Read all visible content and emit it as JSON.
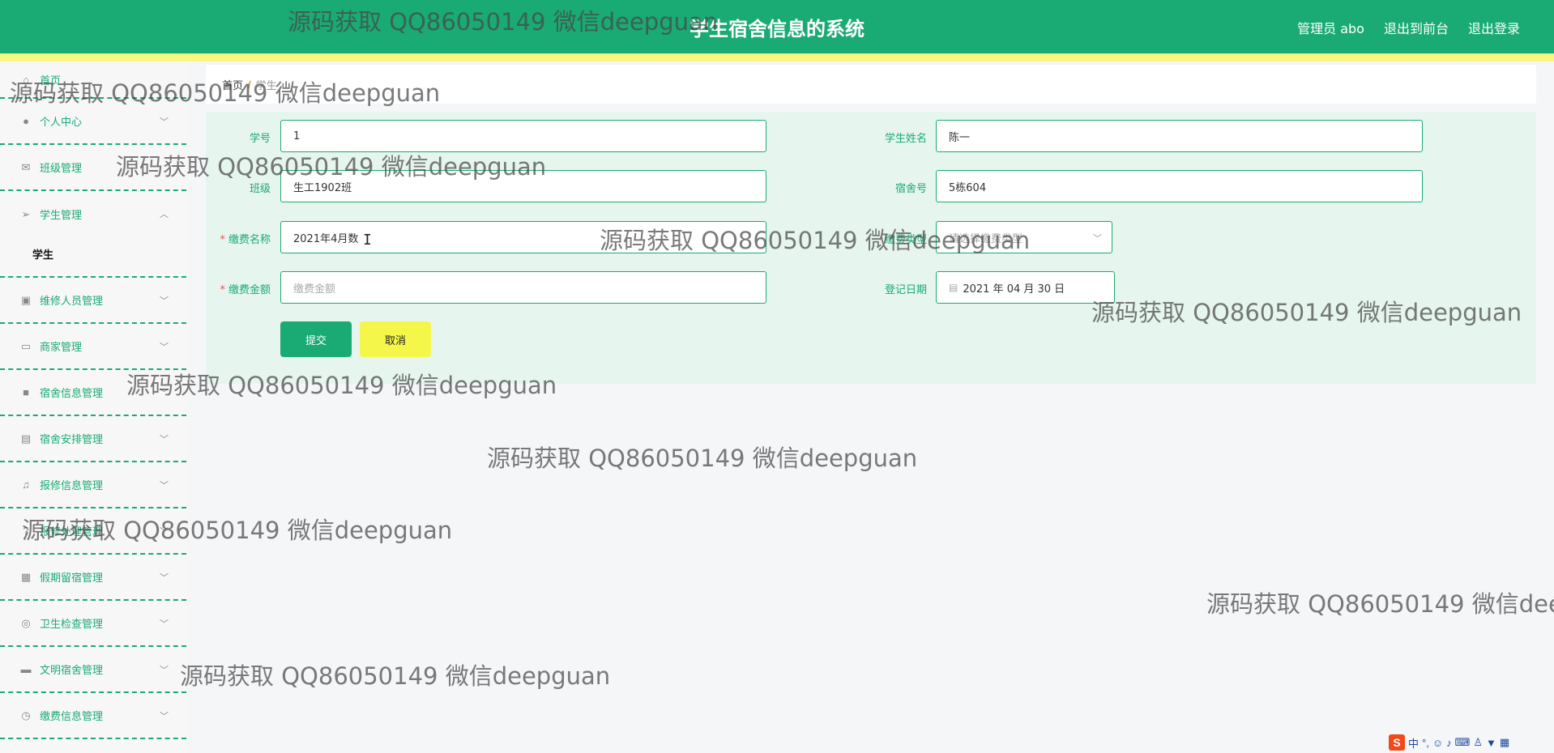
{
  "header": {
    "title": "学生宿舍信息的系统",
    "links": [
      "管理员 abo",
      "退出到前台",
      "退出登录"
    ]
  },
  "sidebar": {
    "items": [
      {
        "label": "首页",
        "icon": "home-icon"
      },
      {
        "label": "个人中心",
        "icon": "user-icon"
      },
      {
        "label": "班级管理",
        "icon": "mail-icon"
      },
      {
        "label": "学生管理",
        "icon": "send-icon",
        "sub": "学生"
      },
      {
        "label": "维修人员管理",
        "icon": "clipboard-x-icon"
      },
      {
        "label": "商家管理",
        "icon": "id-card-icon"
      },
      {
        "label": "宿舍信息管理",
        "icon": "briefcase-icon"
      },
      {
        "label": "宿舍安排管理",
        "icon": "clipboard-icon"
      },
      {
        "label": "报修信息管理",
        "icon": "bell-off-icon"
      },
      {
        "label": "报修处理管理",
        "icon": "help-circle-icon"
      },
      {
        "label": "假期留宿管理",
        "icon": "grid-icon"
      },
      {
        "label": "卫生检查管理",
        "icon": "lifebuoy-icon"
      },
      {
        "label": "文明宿舍管理",
        "icon": "chat-icon"
      },
      {
        "label": "缴费信息管理",
        "icon": "clock-icon"
      }
    ]
  },
  "breadcrumb": {
    "home": "首页",
    "separator": "/",
    "current": "学生"
  },
  "form": {
    "student_no": {
      "label": "学号",
      "value": "1"
    },
    "student_name": {
      "label": "学生姓名",
      "value": "陈一"
    },
    "class": {
      "label": "班级",
      "value": "生工1902班"
    },
    "dorm_no": {
      "label": "宿舍号",
      "value": "5栋604"
    },
    "fee_name": {
      "label": "缴费名称",
      "value": "2021年4月数"
    },
    "fee_type": {
      "label": "缴费类型",
      "placeholder": "请选择缴费类型"
    },
    "fee_amount": {
      "label": "缴费金额",
      "placeholder": "缴费金额"
    },
    "register_date": {
      "label": "登记日期",
      "value": "2021 年 04 月 30 日"
    },
    "submit_label": "提交",
    "cancel_label": "取消"
  },
  "watermark": "源码获取 QQ86050149 微信deepguan",
  "watermark_cut": "源码获取 QQ86050149 微信dee",
  "taskbar": {
    "ime": "中"
  },
  "colors": {
    "primary": "#1aaa74",
    "stripe": "#f8f880",
    "cancel": "#f5f64a",
    "panel": "#e6f5ee"
  }
}
